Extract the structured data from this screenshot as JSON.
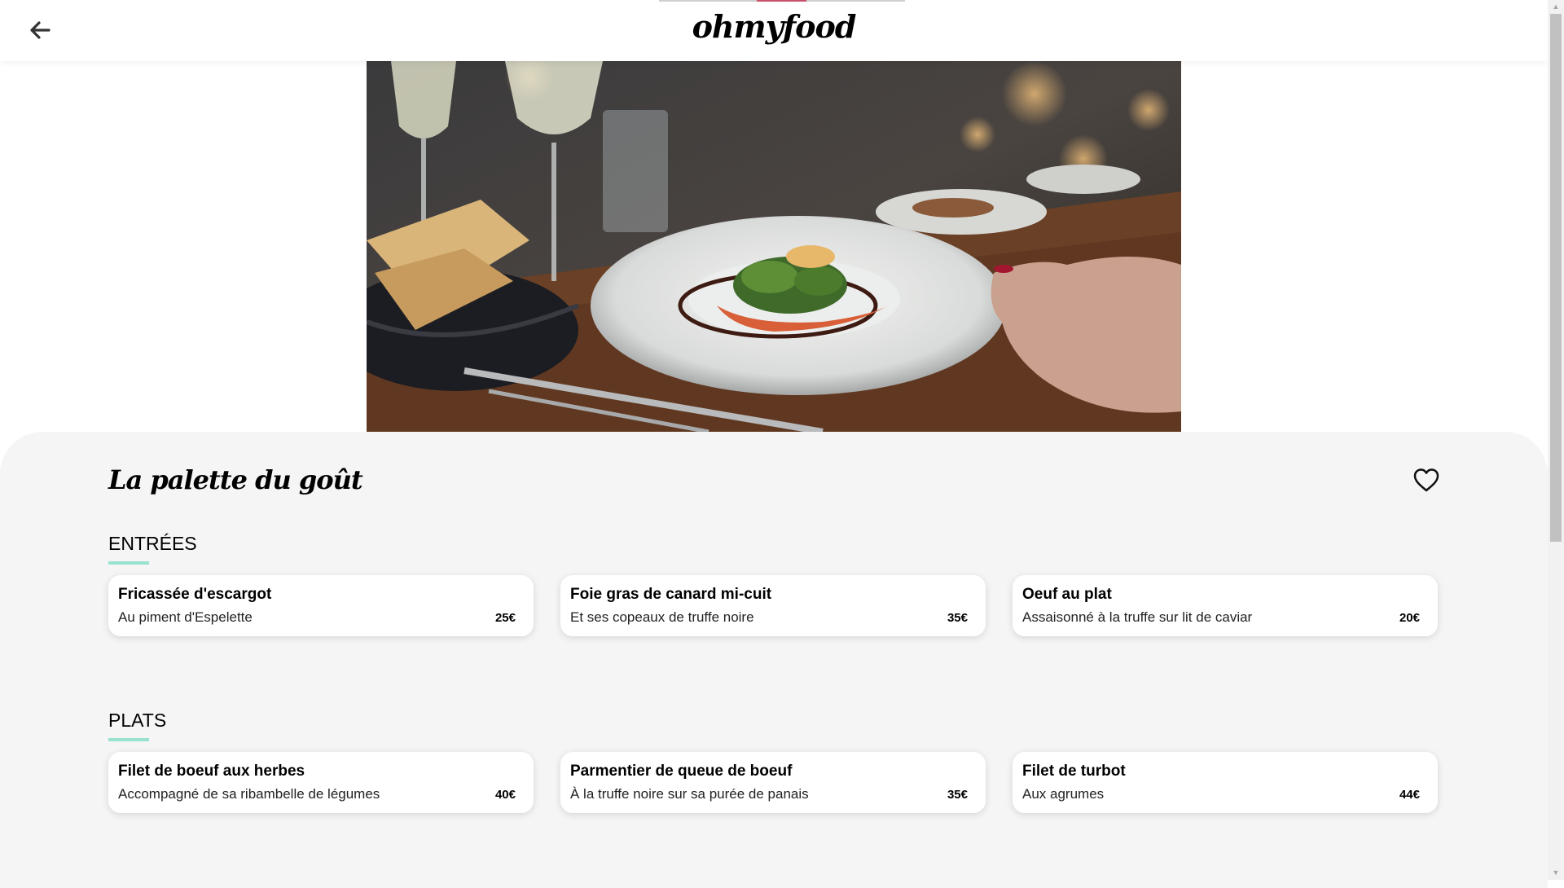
{
  "header": {
    "logo": "ohmyfood",
    "back_icon": "arrow-left-icon"
  },
  "hero": {
    "image_subject": "plated dish with greens and salmon on a restaurant table"
  },
  "restaurant": {
    "name": "La palette du goût",
    "favorite_icon": "heart-outline-icon"
  },
  "sections": [
    {
      "title": "ENTRÉES",
      "dishes": [
        {
          "name": "Fricassée d'escargot",
          "description": "Au piment d'Espelette",
          "price": "25€"
        },
        {
          "name": "Foie gras de canard mi-cuit",
          "description": "Et ses copeaux de truffe noire",
          "price": "35€"
        },
        {
          "name": "Oeuf au plat",
          "description": "Assaisonné à la truffe sur lit de caviar",
          "price": "20€"
        }
      ]
    },
    {
      "title": "PLATS",
      "dishes": [
        {
          "name": "Filet de boeuf aux herbes",
          "description": "Accompagné de sa ribambelle de légumes",
          "price": "40€"
        },
        {
          "name": "Parmentier de queue de boeuf",
          "description": "À la truffe noire sur sa purée de panais",
          "price": "35€"
        },
        {
          "name": "Filet de turbot",
          "description": "Aux agrumes",
          "price": "44€"
        }
      ]
    }
  ],
  "colors": {
    "accent_underline": "#99e2d0",
    "loader_accent": "#c8506a",
    "sheet_background": "#f5f5f5"
  }
}
